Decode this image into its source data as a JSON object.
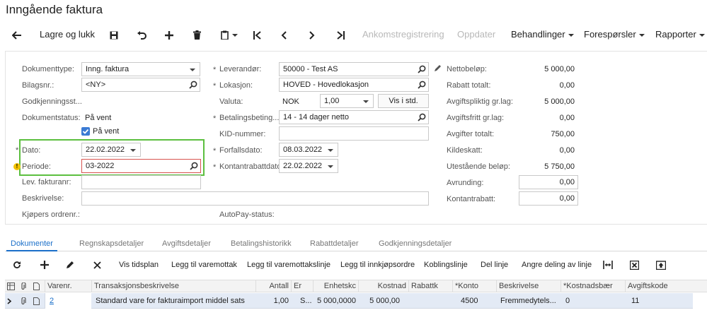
{
  "window_title": "Inngående faktura",
  "toolbar": {
    "save_close": "Lagre og lukk",
    "ankomst": "Ankomstregistrering",
    "oppdater": "Oppdater",
    "behandlinger": "Behandlinger",
    "foresporsler": "Forespørsler",
    "rapporter": "Rapporter"
  },
  "form": {
    "dokumenttype_label": "Dokumenttype:",
    "dokumenttype": "Inng. faktura",
    "bilagsnr_label": "Bilagsnr.:",
    "bilagsnr": "<NY>",
    "godkjenning_label": "Godkjenningsst...",
    "dokumentstatus_label": "Dokumentstatus:",
    "dokumentstatus": "På vent",
    "pa_vent_checkbox": "På vent",
    "dato_label": "Dato:",
    "dato": "22.02.2022",
    "periode_label": "Periode:",
    "periode": "03-2022",
    "lev_fakturanr_label": "Lev. fakturanr:",
    "beskrivelse_label": "Beskrivelse:",
    "kjopers_ordrenr_label": "Kjøpers ordrenr.:",
    "leverandor_label": "Leverandør:",
    "leverandor": "50000 - Test AS",
    "lokasjon_label": "Lokasjon:",
    "lokasjon": "HOVED - Hovedlokasjon",
    "valuta_label": "Valuta:",
    "valuta": "NOK",
    "valuta_rate": "1,00",
    "vis_std": "Vis i std.",
    "betalingsbeting_label": "Betalingsbeting...",
    "betalingsbeting": "14 - 14 dager netto",
    "kid_label": "KID-nummer:",
    "forfallsdato_label": "Forfallsdato:",
    "forfallsdato": "08.03.2022",
    "kontantrabattdato_label": "Kontantrabattdato:",
    "kontantrabattdato": "22.02.2022",
    "autopay_label": "AutoPay-status:",
    "nettobelop_label": "Nettobeløp:",
    "nettobelop": "5 000,00",
    "rabatt_label": "Rabatt totalt:",
    "rabatt": "0,00",
    "avgiftspliktig_label": "Avgiftspliktig gr.lag:",
    "avgiftspliktig": "5 000,00",
    "avgiftsfritt_label": "Avgiftsfritt gr.lag:",
    "avgiftsfritt": "0,00",
    "avgifter_label": "Avgifter totalt:",
    "avgifter": "750,00",
    "kildeskatt_label": "Kildeskatt:",
    "kildeskatt": "0,00",
    "utestaende_label": "Utestående beløp:",
    "utestaende": "5 750,00",
    "avrunding_label": "Avrunding:",
    "avrunding": "0,00",
    "kontantrabatt_label": "Kontantrabatt:",
    "kontantrabatt": "0,00"
  },
  "tabs": [
    "Dokumenter",
    "Regnskapsdetaljer",
    "Avgiftsdetaljer",
    "Betalingshistorikk",
    "Rabattdetaljer",
    "Godkjenningsdetaljer"
  ],
  "grid_toolbar": {
    "vis_tidsplan": "Vis tidsplan",
    "legg_varemottak": "Legg til varemottak",
    "legg_varemottakslinje": "Legg til varemottakslinje",
    "legg_innkjopsordre": "Legg til innkjøpsordre",
    "koblingslinje": "Koblingslinje",
    "del_linje": "Del linje",
    "angre_deling": "Angre deling av linje"
  },
  "grid": {
    "columns": [
      "Varenr.",
      "Transaksjonsbeskrivelse",
      "Antall",
      "Er",
      "Enhetskc",
      "Kostnad",
      "Rabattk",
      "*Konto",
      "Beskrivelse",
      "*Kostnadsbær",
      "Avgiftskode"
    ],
    "row": {
      "varenr": "2",
      "transaksjonsbeskrivelse": "Standard vare for fakturaimport middel sats",
      "antall": "1,00",
      "er": "S...",
      "enhetskost": "5 000,0000",
      "kostnad": "5 000,00",
      "rabattk": "",
      "konto": "4500",
      "beskrivelse": "Fremmedytels...",
      "kostnadsbaer": "0",
      "avgiftskode": "11"
    }
  },
  "colors": {
    "accent": "#1a6fc9",
    "highlight_box": "#5cbf3f",
    "row_selected": "#e3eaf5"
  }
}
